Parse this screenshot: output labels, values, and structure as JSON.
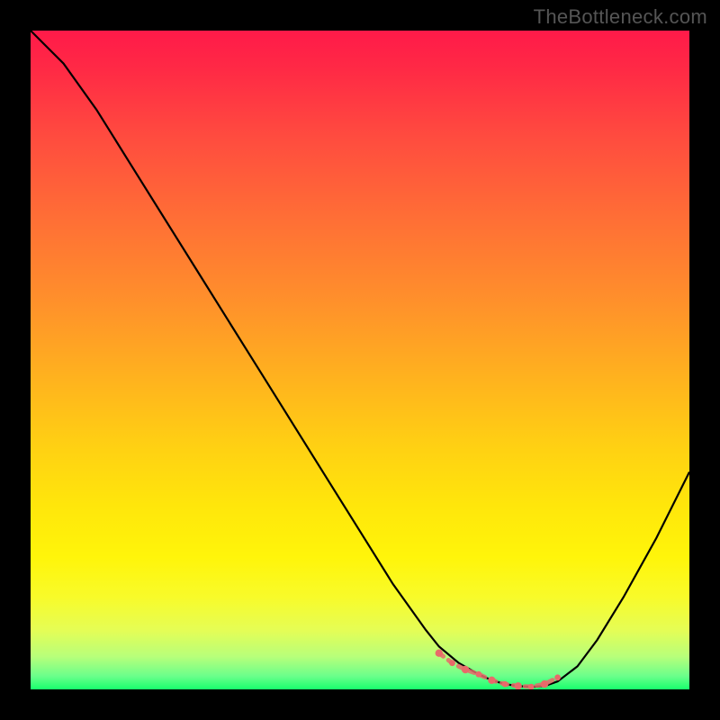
{
  "watermark": "TheBottleneck.com",
  "colors": {
    "page_bg": "#000000",
    "watermark": "#555555",
    "curve": "#000000",
    "marker": "#e86a6a",
    "gradient_stops": [
      "#ff1a49",
      "#ff2a45",
      "#ff4b3f",
      "#ff6d36",
      "#ff8d2c",
      "#ffb01f",
      "#ffd013",
      "#ffe60b",
      "#fff50a",
      "#f8fb2a",
      "#e5fd55",
      "#b8ff7a",
      "#6aff8b",
      "#18ff6d"
    ]
  },
  "chart_data": {
    "type": "line",
    "title": "",
    "xlabel": "",
    "ylabel": "",
    "xlim": [
      0,
      100
    ],
    "ylim": [
      0,
      100
    ],
    "grid": false,
    "legend": false,
    "x": [
      0,
      2,
      5,
      10,
      15,
      20,
      25,
      30,
      35,
      40,
      45,
      50,
      55,
      60,
      62,
      65,
      68,
      70,
      72,
      74,
      76,
      78,
      80,
      83,
      86,
      90,
      95,
      100
    ],
    "values": [
      100,
      98,
      95,
      88,
      80,
      72,
      64,
      56,
      48,
      40,
      32,
      24,
      16,
      9,
      6.5,
      4,
      2.3,
      1.4,
      0.8,
      0.5,
      0.4,
      0.5,
      1.2,
      3.5,
      7.5,
      14,
      23,
      33
    ],
    "markers": {
      "type": "points",
      "color": "#e86a6a",
      "x": [
        62,
        64,
        66,
        68,
        70,
        72,
        74,
        76,
        78,
        80
      ],
      "y": [
        5.5,
        4.0,
        3.0,
        2.3,
        1.4,
        0.8,
        0.5,
        0.4,
        0.8,
        1.8
      ]
    },
    "annotations": [
      {
        "text": "TheBottleneck.com",
        "position": "top-right"
      }
    ]
  }
}
